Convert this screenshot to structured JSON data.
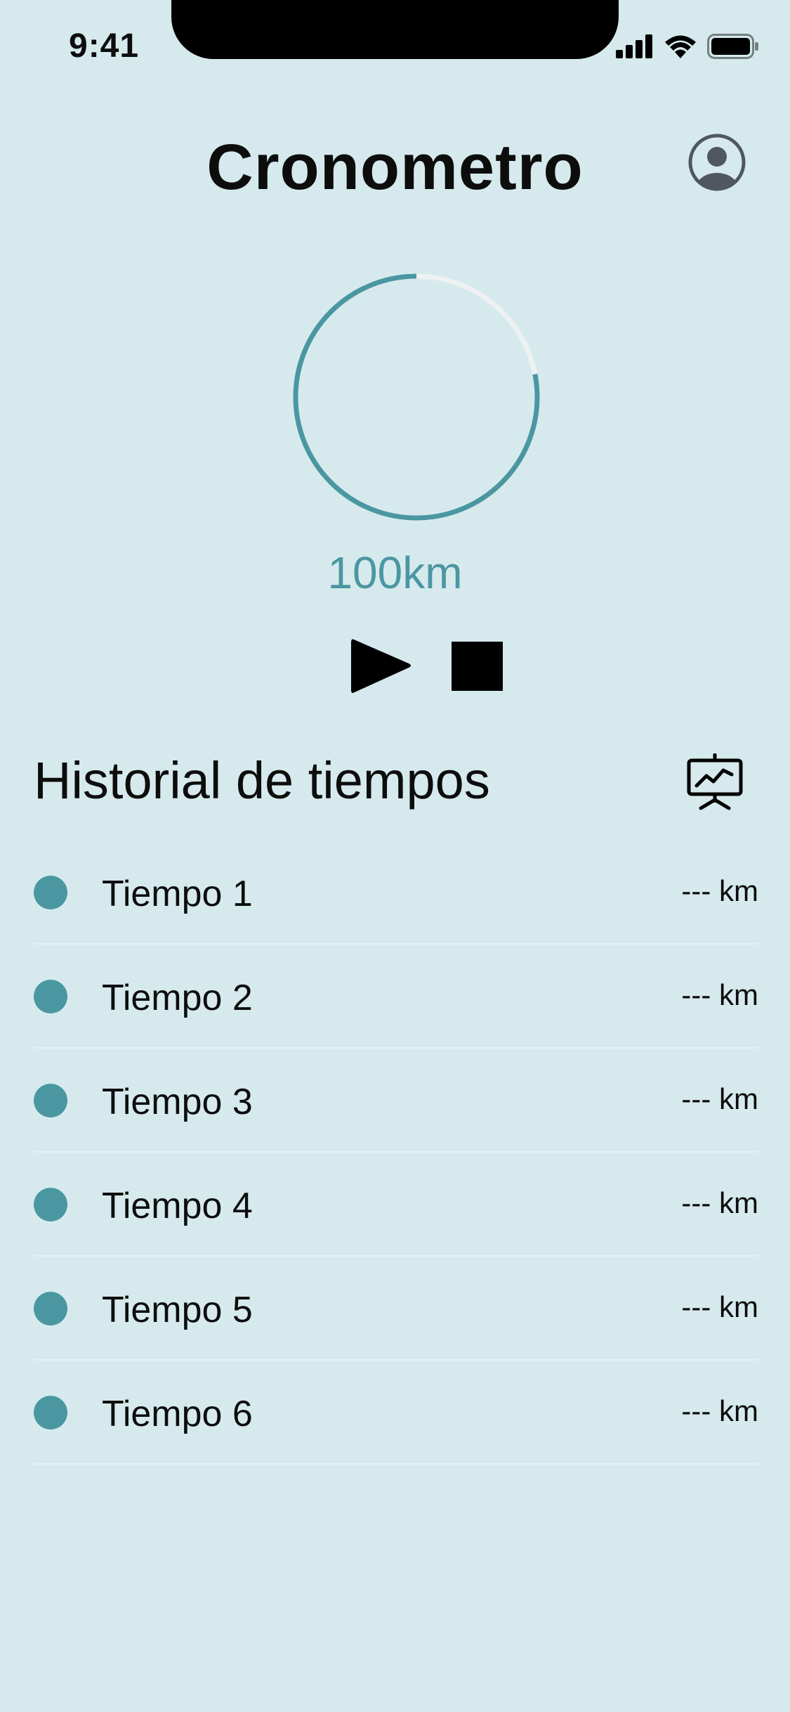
{
  "status_bar": {
    "time": "9:41",
    "icons": [
      "signal-icon",
      "wifi-icon",
      "battery-icon"
    ]
  },
  "header": {
    "title": "Cronometro",
    "profile_icon": "user-circle-icon"
  },
  "progress": {
    "label": "100km",
    "fraction": 0.78,
    "color": "#4b97a1",
    "track_color": "#eef1f1"
  },
  "controls": {
    "play_icon": "play-icon",
    "stop_icon": "stop-icon"
  },
  "history": {
    "title": "Historial de tiempos",
    "chart_icon": "presentation-chart-icon",
    "items": [
      {
        "label": "Tiempo 1",
        "value": "--- km"
      },
      {
        "label": "Tiempo 2",
        "value": "--- km"
      },
      {
        "label": "Tiempo 3",
        "value": "--- km"
      },
      {
        "label": "Tiempo 4",
        "value": "--- km"
      },
      {
        "label": "Tiempo 5",
        "value": "--- km"
      },
      {
        "label": "Tiempo 6",
        "value": "--- km"
      }
    ]
  },
  "colors": {
    "background": "#d6eaed",
    "accent": "#4b97a1"
  }
}
